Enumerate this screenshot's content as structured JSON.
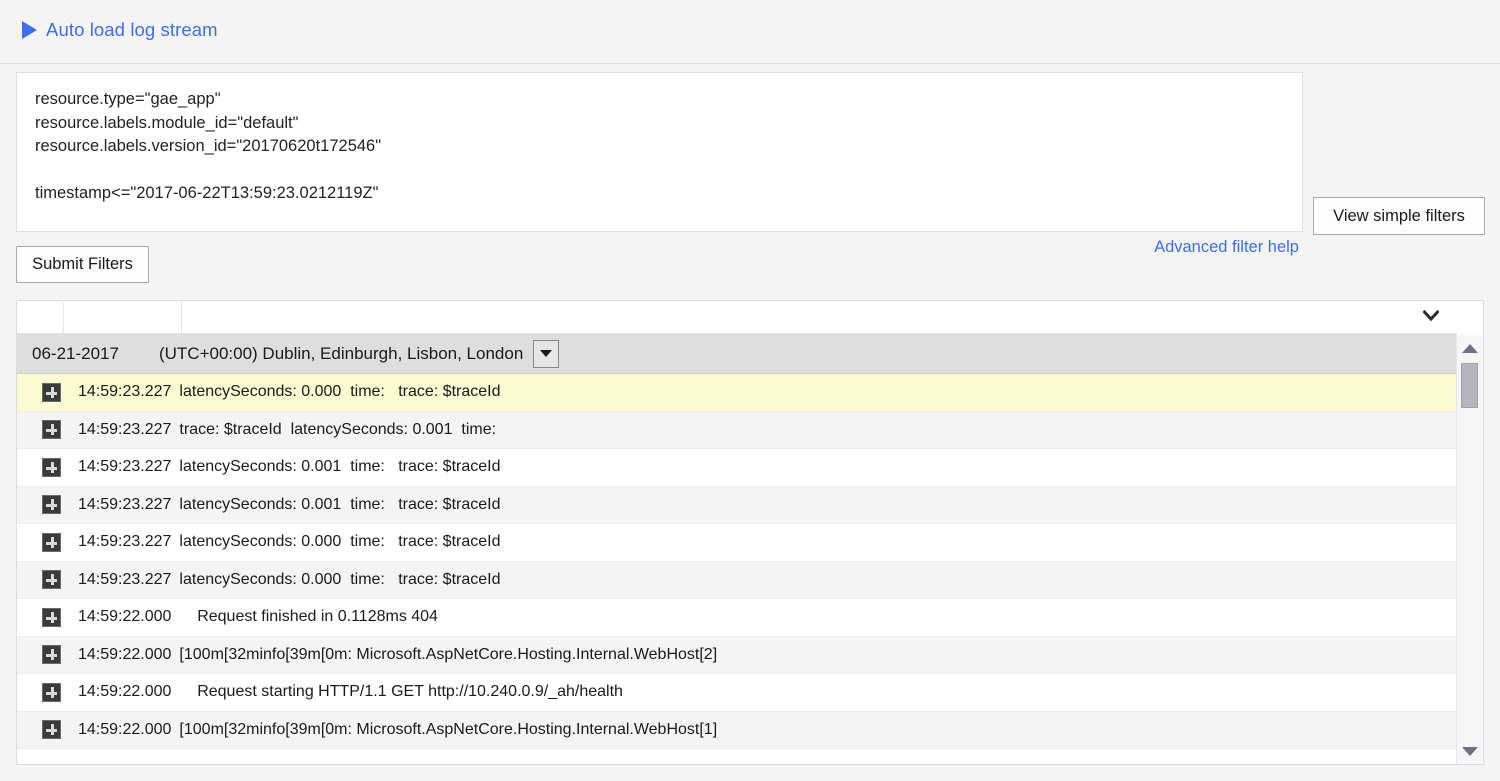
{
  "toolbar": {
    "autoload_label": "Auto load log stream",
    "play_icon": "play-triangle-icon",
    "accent_blue": "#3b6ff0"
  },
  "filters": {
    "query_text": "resource.type=\"gae_app\"\nresource.labels.module_id=\"default\"\nresource.labels.version_id=\"20170620t172546\"\n\ntimestamp<=\"2017-06-22T13:59:23.0212119Z\"",
    "placeholder": "",
    "submit_label": "Submit Filters",
    "view_simple_label": "View simple filters",
    "advanced_help_label": "Advanced filter help"
  },
  "log_table": {
    "header_chevron_icon": "chevron-down-icon",
    "date": "06-21-2017",
    "timezone": "(UTC+00:00) Dublin, Edinburgh, Lisbon, London",
    "timezone_dropdown_icon": "caret-down-icon",
    "expand_icon": "expand-entry-icon",
    "highlight_color": "#fbfbd2",
    "rows": [
      {
        "time": "14:59:23.227",
        "message": "latencySeconds: 0.000  time:   trace: $traceId",
        "highlight": true
      },
      {
        "time": "14:59:23.227",
        "message": "trace: $traceId  latencySeconds: 0.001  time:",
        "highlight": false
      },
      {
        "time": "14:59:23.227",
        "message": "latencySeconds: 0.001  time:   trace: $traceId",
        "highlight": false
      },
      {
        "time": "14:59:23.227",
        "message": "latencySeconds: 0.001  time:   trace: $traceId",
        "highlight": false
      },
      {
        "time": "14:59:23.227",
        "message": "latencySeconds: 0.000  time:   trace: $traceId",
        "highlight": false
      },
      {
        "time": "14:59:23.227",
        "message": "latencySeconds: 0.000  time:   trace: $traceId",
        "highlight": false
      },
      {
        "time": "14:59:22.000",
        "message": "    Request finished in 0.1128ms 404",
        "highlight": false
      },
      {
        "time": "14:59:22.000",
        "message": "[100m[32minfo[39m[0m: Microsoft.AspNetCore.Hosting.Internal.WebHost[2]",
        "highlight": false
      },
      {
        "time": "14:59:22.000",
        "message": "    Request starting HTTP/1.1 GET http://10.240.0.9/_ah/health",
        "highlight": false
      },
      {
        "time": "14:59:22.000",
        "message": "[100m[32minfo[39m[0m: Microsoft.AspNetCore.Hosting.Internal.WebHost[1]",
        "highlight": false
      }
    ],
    "scrollbar": {
      "up_icon": "scroll-up-arrow-icon",
      "down_icon": "scroll-down-arrow-icon",
      "thumb": "scroll-thumb"
    }
  }
}
